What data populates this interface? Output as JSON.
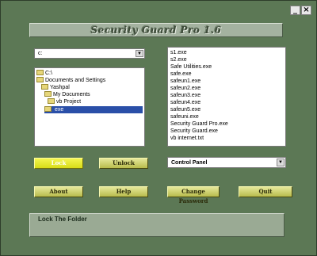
{
  "window": {
    "minimize_label": "_",
    "close_label": "×",
    "title": "Security Guard Pro 1.6"
  },
  "drive_select": {
    "value": "c:",
    "arrow": "▼"
  },
  "tree": {
    "items": [
      {
        "label": "C:\\",
        "depth": 0,
        "selected": false
      },
      {
        "label": "Documents and Settings",
        "depth": 0,
        "selected": false
      },
      {
        "label": "Yashpal",
        "depth": 1,
        "selected": false
      },
      {
        "label": "My Documents",
        "depth": 2,
        "selected": false
      },
      {
        "label": "vb Project",
        "depth": 3,
        "selected": false
      },
      {
        "label": "exe",
        "depth": 4,
        "selected": true
      }
    ]
  },
  "files": [
    "s1.exe",
    "s2.exe",
    "Safe Utilities.exe",
    "safe.exe",
    "safeun1.exe",
    "safeun2.exe",
    "safeun3.exe",
    "safeun4.exe",
    "safeun5.exe",
    "safeuni.exe",
    "Security Guard Pro.exe",
    "Security Guard.exe",
    "vb internet.txt"
  ],
  "buttons": {
    "lock": "Lock",
    "unlock": "Unlock",
    "about": "About",
    "help": "Help",
    "change_password": "Change Password",
    "quit": "Quit"
  },
  "target_select": {
    "value": "Control Panel",
    "arrow": "▼"
  },
  "status_text": "Lock The Folder"
}
